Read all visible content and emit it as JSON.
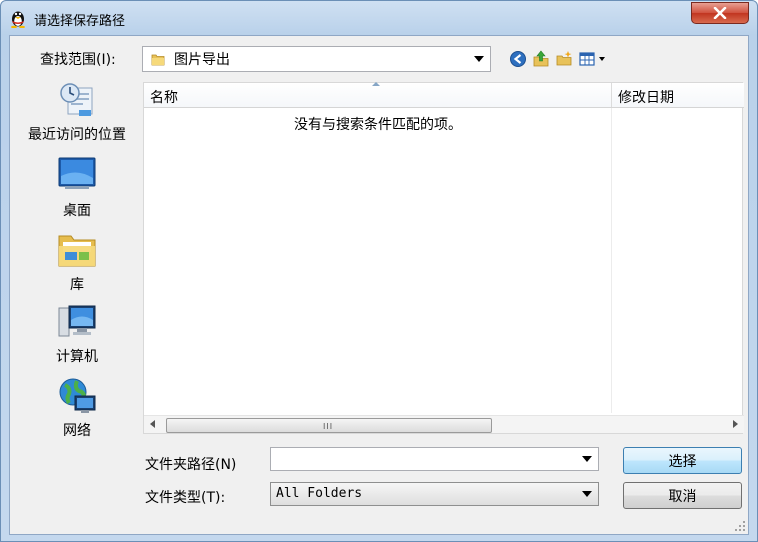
{
  "window": {
    "title": "请选择保存路径",
    "close_label": "✕",
    "colors": {
      "title_gradient_top": "#cfe0f2",
      "close_red": "#c13520",
      "accent_blue": "#3c7fb1"
    }
  },
  "lookin": {
    "label": "查找范围(I):",
    "value": "图片导出"
  },
  "toolbar": {
    "icons": [
      "back-icon",
      "up-folder-icon",
      "new-folder-icon",
      "view-menu-icon"
    ]
  },
  "places": [
    {
      "label": "最近访问的位置",
      "icon": "recent-places-icon"
    },
    {
      "label": "桌面",
      "icon": "desktop-icon"
    },
    {
      "label": "库",
      "icon": "libraries-icon"
    },
    {
      "label": "计算机",
      "icon": "computer-icon"
    },
    {
      "label": "网络",
      "icon": "network-icon"
    }
  ],
  "filelist": {
    "columns": [
      "名称",
      "修改日期"
    ],
    "empty_message": "没有与搜索条件匹配的项。",
    "scroll_grip": "III"
  },
  "form": {
    "path_label": "文件夹路径(N)",
    "path_value": "",
    "type_label": "文件类型(T):",
    "type_value": "All Folders"
  },
  "buttons": {
    "ok": "选择",
    "cancel": "取消"
  }
}
